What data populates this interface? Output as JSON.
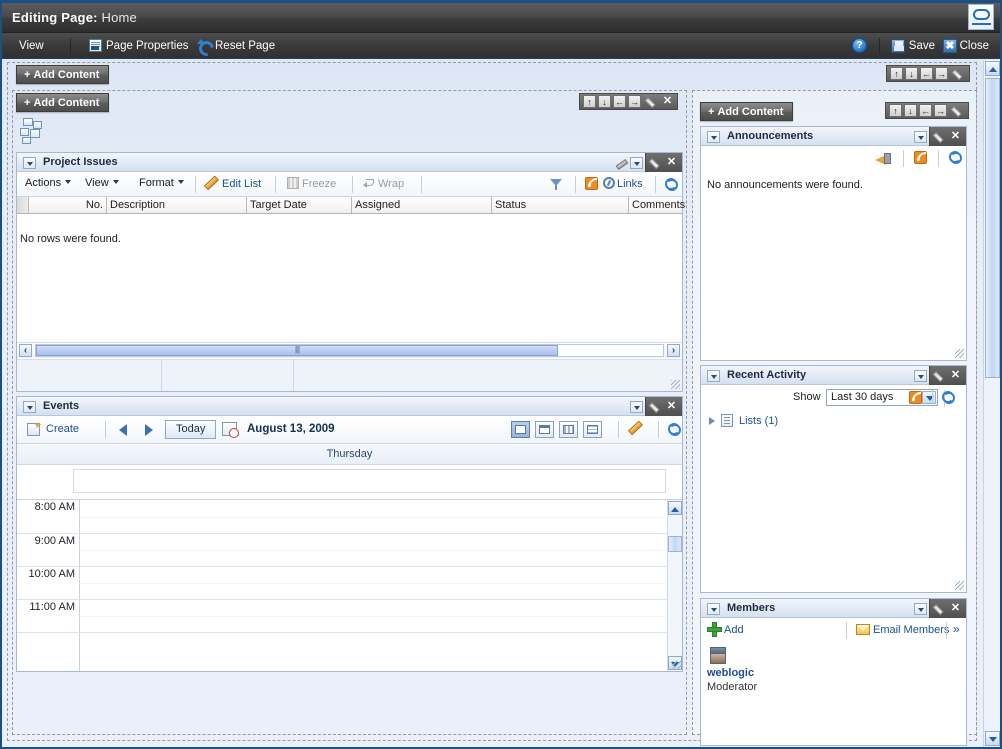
{
  "window": {
    "title_prefix": "Editing Page:",
    "page_name": "Home",
    "logo": "oracle-logo"
  },
  "menubar": {
    "view_label": "View",
    "page_properties_label": "Page Properties",
    "reset_page_label": "Reset Page",
    "help_label": "?",
    "save_label": "Save",
    "close_label": "Close"
  },
  "layout": {
    "add_content_label": "+ Add Content",
    "controls": {
      "move_up": "↑",
      "move_down": "↓",
      "move_left": "←",
      "move_right": "→",
      "edit": "edit-pencil",
      "remove": "✕"
    }
  },
  "project_issues": {
    "title": "Project Issues",
    "toolbar": {
      "actions": "Actions",
      "view": "View",
      "format": "Format",
      "edit_list": "Edit List",
      "freeze": "Freeze",
      "wrap": "Wrap",
      "links": "Links"
    },
    "columns": [
      "No.",
      "Description",
      "Target Date",
      "Assigned",
      "Status",
      "Comments"
    ],
    "empty_message": "No rows were found.",
    "rows": []
  },
  "events": {
    "title": "Events",
    "create_label": "Create",
    "today_label": "Today",
    "current_date": "August 13, 2009",
    "day_header": "Thursday",
    "time_slots": [
      "8:00 AM",
      "9:00 AM",
      "10:00 AM",
      "11:00 AM"
    ],
    "views": [
      "day-view",
      "week-view",
      "month-view",
      "list-view"
    ],
    "active_view": "day-view"
  },
  "announcements": {
    "title": "Announcements",
    "empty_message": "No announcements were found."
  },
  "recent_activity": {
    "title": "Recent Activity",
    "show_label": "Show",
    "range_value": "Last 30 days",
    "range_options": [
      "Last 30 days"
    ],
    "tree_item": "Lists (1)"
  },
  "members": {
    "title": "Members",
    "add_label": "Add",
    "email_label": "Email Members",
    "more_label": "»",
    "list": [
      {
        "name": "weblogic",
        "role": "Moderator"
      }
    ]
  },
  "colors": {
    "accent": "#1d4f91",
    "titlebar": "#3c3c3c",
    "page_bg": "#e7eef8",
    "rss_orange": "#ef8b20"
  }
}
